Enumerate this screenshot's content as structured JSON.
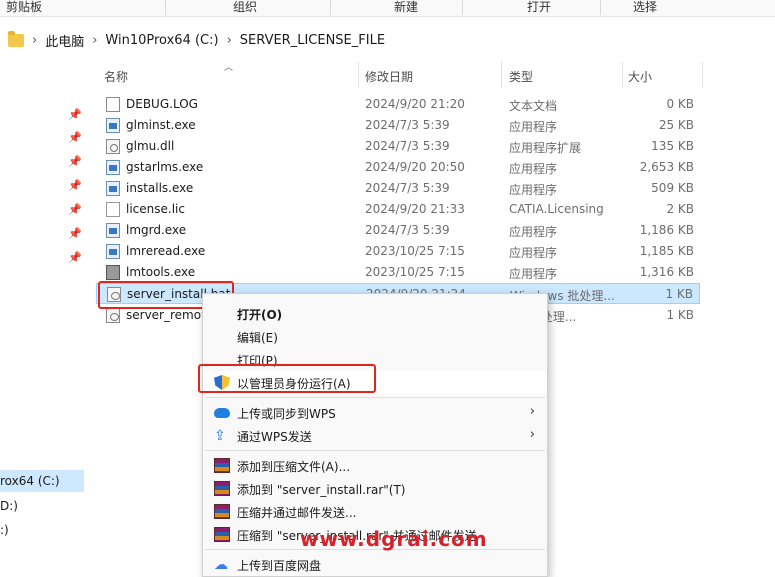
{
  "ribbon": {
    "groups": [
      "剪贴板",
      "组织",
      "新建",
      "打开",
      "选择"
    ]
  },
  "address": {
    "crumbs": [
      "此电脑",
      "Win10Prox64 (C:)",
      "SERVER_LICENSE_FILE"
    ]
  },
  "nav": {
    "selected_drive": "rox64 (C:)",
    "item2": "D:)",
    "item3": ":)"
  },
  "columns": {
    "name": "名称",
    "date": "修改日期",
    "type": "类型",
    "size": "大小"
  },
  "files": [
    {
      "name": "DEBUG.LOG",
      "date": "2024/9/20 21:20",
      "type": "文本文档",
      "size": "0 KB",
      "icon": "log-file-icon"
    },
    {
      "name": "glminst.exe",
      "date": "2024/7/3 5:39",
      "type": "应用程序",
      "size": "25 KB",
      "icon": "exe-icon"
    },
    {
      "name": "glmu.dll",
      "date": "2024/7/3 5:39",
      "type": "应用程序扩展",
      "size": "135 KB",
      "icon": "dll-icon"
    },
    {
      "name": "gstarlms.exe",
      "date": "2024/9/20 20:50",
      "type": "应用程序",
      "size": "2,653 KB",
      "icon": "exe-icon"
    },
    {
      "name": "installs.exe",
      "date": "2024/7/3 5:39",
      "type": "应用程序",
      "size": "509 KB",
      "icon": "exe-icon"
    },
    {
      "name": "license.lic",
      "date": "2024/9/20 21:33",
      "type": "CATIA.Licensing",
      "size": "2 KB",
      "icon": "license-file-icon"
    },
    {
      "name": "lmgrd.exe",
      "date": "2024/7/3 5:39",
      "type": "应用程序",
      "size": "1,186 KB",
      "icon": "exe-icon"
    },
    {
      "name": "lmreread.exe",
      "date": "2023/10/25 7:15",
      "type": "应用程序",
      "size": "1,185 KB",
      "icon": "exe-icon"
    },
    {
      "name": "lmtools.exe",
      "date": "2023/10/25 7:15",
      "type": "应用程序",
      "size": "1,316 KB",
      "icon": "tools-exe-icon"
    },
    {
      "name": "server_install.bat",
      "date": "2024/9/20 21:24",
      "type": "Windows 批处理...",
      "size": "1 KB",
      "icon": "bat-file-icon"
    },
    {
      "name": "server_remov",
      "date": "",
      "type": "ws 批处理...",
      "size": "1 KB",
      "icon": "bat-file-icon"
    }
  ],
  "context_menu": {
    "open": "打开(O)",
    "edit": "编辑(E)",
    "print": "打印(P)",
    "run_as_admin": "以管理员身份运行(A)",
    "upload_wps": "上传或同步到WPS",
    "send_wps": "通过WPS发送",
    "add_archive": "添加到压缩文件(A)...",
    "add_rar": "添加到 \"server_install.rar\"(T)",
    "compress_email": "压缩并通过邮件发送...",
    "compress_rar_email": "压缩到 \"server_install.rar\" 并通过邮件发送",
    "baidu": "上传到百度网盘"
  },
  "watermark": "www.dgrai.com",
  "colors": {
    "highlight_red": "#e0261f",
    "selection_blue": "#cce8ff",
    "watermark_red": "#d6232b"
  }
}
